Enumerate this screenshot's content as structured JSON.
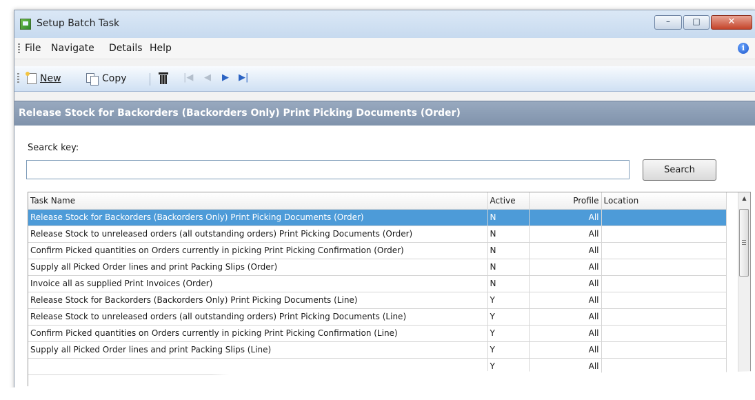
{
  "window": {
    "title": "Setup Batch Task",
    "controls": {
      "minimize": "–",
      "maximize": "□",
      "close": "✕"
    }
  },
  "menu": {
    "items": [
      "File",
      "Navigate",
      "Details",
      "Help"
    ],
    "info_icon": "i"
  },
  "toolbar": {
    "new_label": "New",
    "copy_label": "Copy",
    "nav": {
      "first": "|◀",
      "prev": "◀",
      "next": "▶",
      "last": "▶|"
    }
  },
  "header": {
    "title": "Release Stock for Backorders (Backorders Only) Print Picking Documents (Order)"
  },
  "search": {
    "label": "Searck key:",
    "value": "",
    "button_label": "Search"
  },
  "grid": {
    "columns": [
      "Task Name",
      "Active",
      "Profile",
      "Location"
    ],
    "selected_index": 0,
    "rows": [
      {
        "task": "Release Stock for Backorders (Backorders Only) Print Picking Documents (Order)",
        "active": "N",
        "profile": "All",
        "location": ""
      },
      {
        "task": "Release Stock to unreleased orders (all outstanding orders) Print Picking Documents (Order)",
        "active": "N",
        "profile": "All",
        "location": ""
      },
      {
        "task": "Confirm Picked quantities on Orders currently in picking Print Picking Confirmation (Order)",
        "active": "N",
        "profile": "All",
        "location": ""
      },
      {
        "task": "Supply all Picked Order lines and print Packing Slips (Order)",
        "active": "N",
        "profile": "All",
        "location": ""
      },
      {
        "task": "Invoice all as supplied Print Invoices (Order)",
        "active": "N",
        "profile": "All",
        "location": ""
      },
      {
        "task": "Release Stock for Backorders (Backorders Only) Print Picking Documents (Line)",
        "active": "Y",
        "profile": "All",
        "location": ""
      },
      {
        "task": "Release Stock to unreleased orders (all outstanding orders) Print Picking Documents (Line)",
        "active": "Y",
        "profile": "All",
        "location": ""
      },
      {
        "task": "Confirm Picked quantities on Orders currently in picking Print Picking Confirmation (Line)",
        "active": "Y",
        "profile": "All",
        "location": ""
      },
      {
        "task": "Supply all Picked Order lines and print Packing Slips (Line)",
        "active": "Y",
        "profile": "All",
        "location": ""
      },
      {
        "task": "",
        "active": "Y",
        "profile": "All",
        "location": ""
      }
    ]
  }
}
